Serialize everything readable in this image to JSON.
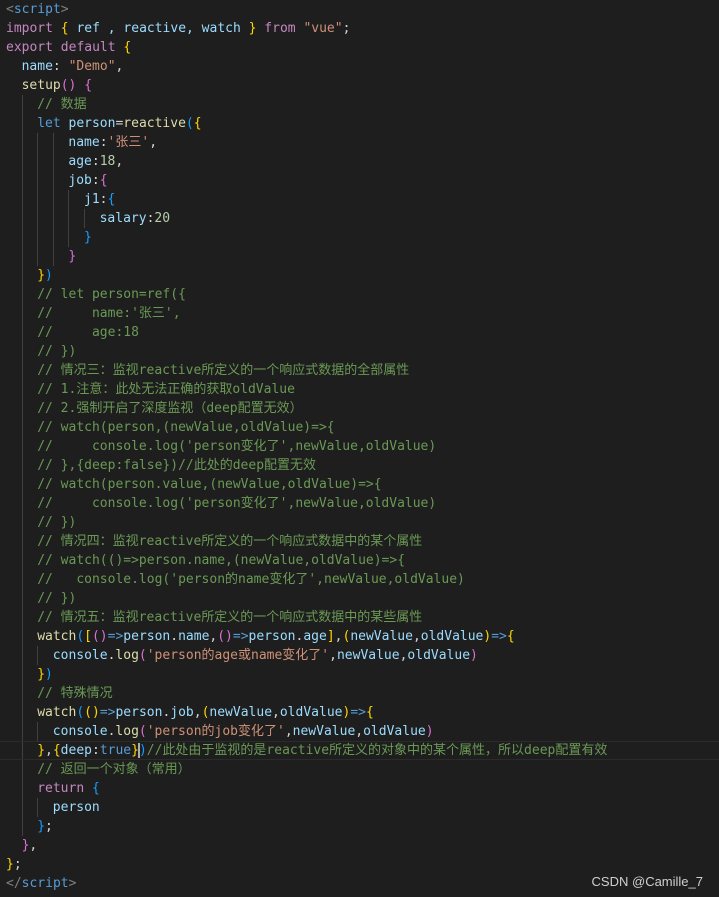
{
  "watermark": "CSDN @Camille_7",
  "lines": [
    {
      "indent": 0,
      "tokens": [
        {
          "t": "<",
          "c": "t-tag"
        },
        {
          "t": "script",
          "c": "t-tagname"
        },
        {
          "t": ">",
          "c": "t-tag"
        }
      ]
    },
    {
      "indent": 0,
      "tokens": [
        {
          "t": "import",
          "c": "t-kw"
        },
        {
          "t": " ",
          "c": "t-plain"
        },
        {
          "t": "{",
          "c": "t-br1"
        },
        {
          "t": " ref , reactive, watch ",
          "c": "t-var"
        },
        {
          "t": "}",
          "c": "t-br1"
        },
        {
          "t": " from ",
          "c": "t-kw"
        },
        {
          "t": "\"vue\"",
          "c": "t-str"
        },
        {
          "t": ";",
          "c": "t-plain"
        }
      ]
    },
    {
      "indent": 0,
      "tokens": [
        {
          "t": "export",
          "c": "t-kw"
        },
        {
          "t": " ",
          "c": "t-plain"
        },
        {
          "t": "default",
          "c": "t-kw"
        },
        {
          "t": " ",
          "c": "t-plain"
        },
        {
          "t": "{",
          "c": "t-br1"
        }
      ]
    },
    {
      "indent": 1,
      "tokens": [
        {
          "t": "name",
          "c": "t-var"
        },
        {
          "t": ": ",
          "c": "t-plain"
        },
        {
          "t": "\"Demo\"",
          "c": "t-str"
        },
        {
          "t": ",",
          "c": "t-plain"
        }
      ]
    },
    {
      "indent": 1,
      "tokens": [
        {
          "t": "setup",
          "c": "t-fn"
        },
        {
          "t": "()",
          "c": "t-br2"
        },
        {
          "t": " ",
          "c": "t-plain"
        },
        {
          "t": "{",
          "c": "t-br2"
        }
      ]
    },
    {
      "indent": 2,
      "tokens": [
        {
          "t": "// 数据",
          "c": "t-com"
        }
      ]
    },
    {
      "indent": 2,
      "tokens": [
        {
          "t": "let",
          "c": "t-kw2"
        },
        {
          "t": " ",
          "c": "t-plain"
        },
        {
          "t": "person",
          "c": "t-var"
        },
        {
          "t": "=",
          "c": "t-plain"
        },
        {
          "t": "reactive",
          "c": "t-fn"
        },
        {
          "t": "(",
          "c": "t-br3"
        },
        {
          "t": "{",
          "c": "t-br1"
        }
      ]
    },
    {
      "indent": 4,
      "tokens": [
        {
          "t": "name",
          "c": "t-var"
        },
        {
          "t": ":",
          "c": "t-plain"
        },
        {
          "t": "'张三'",
          "c": "t-str"
        },
        {
          "t": ",",
          "c": "t-plain"
        }
      ]
    },
    {
      "indent": 4,
      "tokens": [
        {
          "t": "age",
          "c": "t-var"
        },
        {
          "t": ":",
          "c": "t-plain"
        },
        {
          "t": "18",
          "c": "t-num"
        },
        {
          "t": ",",
          "c": "t-plain"
        }
      ]
    },
    {
      "indent": 4,
      "tokens": [
        {
          "t": "job",
          "c": "t-var"
        },
        {
          "t": ":",
          "c": "t-plain"
        },
        {
          "t": "{",
          "c": "t-br2"
        }
      ]
    },
    {
      "indent": 5,
      "tokens": [
        {
          "t": "j1",
          "c": "t-var"
        },
        {
          "t": ":",
          "c": "t-plain"
        },
        {
          "t": "{",
          "c": "t-br3"
        }
      ]
    },
    {
      "indent": 6,
      "tokens": [
        {
          "t": "salary",
          "c": "t-var"
        },
        {
          "t": ":",
          "c": "t-plain"
        },
        {
          "t": "20",
          "c": "t-num"
        }
      ]
    },
    {
      "indent": 5,
      "tokens": [
        {
          "t": "}",
          "c": "t-br3"
        }
      ]
    },
    {
      "indent": 4,
      "tokens": [
        {
          "t": "}",
          "c": "t-br2"
        }
      ]
    },
    {
      "indent": 2,
      "tokens": [
        {
          "t": "}",
          "c": "t-br1"
        },
        {
          "t": ")",
          "c": "t-br3"
        }
      ]
    },
    {
      "indent": 2,
      "tokens": [
        {
          "t": "// let person=ref({",
          "c": "t-com"
        }
      ]
    },
    {
      "indent": 2,
      "tokens": [
        {
          "t": "//     name:'张三',",
          "c": "t-com"
        }
      ]
    },
    {
      "indent": 2,
      "tokens": [
        {
          "t": "//     age:18",
          "c": "t-com"
        }
      ]
    },
    {
      "indent": 2,
      "tokens": [
        {
          "t": "// })",
          "c": "t-com"
        }
      ]
    },
    {
      "indent": 2,
      "tokens": [
        {
          "t": "// 情况三：监视reactive所定义的一个响应式数据的全部属性",
          "c": "t-com"
        }
      ]
    },
    {
      "indent": 2,
      "tokens": [
        {
          "t": "// 1.注意：此处无法正确的获取oldValue",
          "c": "t-com"
        }
      ]
    },
    {
      "indent": 2,
      "tokens": [
        {
          "t": "// 2.强制开启了深度监视（deep配置无效）",
          "c": "t-com"
        }
      ]
    },
    {
      "indent": 2,
      "tokens": [
        {
          "t": "// watch(person,(newValue,oldValue)=>{",
          "c": "t-com"
        }
      ]
    },
    {
      "indent": 2,
      "tokens": [
        {
          "t": "//     console.log('person变化了',newValue,oldValue)",
          "c": "t-com"
        }
      ]
    },
    {
      "indent": 2,
      "tokens": [
        {
          "t": "// },{deep:false})//此处的deep配置无效",
          "c": "t-com"
        }
      ]
    },
    {
      "indent": 2,
      "tokens": [
        {
          "t": "// watch(person.value,(newValue,oldValue)=>{",
          "c": "t-com"
        }
      ]
    },
    {
      "indent": 2,
      "tokens": [
        {
          "t": "//     console.log('person变化了',newValue,oldValue)",
          "c": "t-com"
        }
      ]
    },
    {
      "indent": 2,
      "tokens": [
        {
          "t": "// })",
          "c": "t-com"
        }
      ]
    },
    {
      "indent": 2,
      "tokens": [
        {
          "t": "// 情况四：监视reactive所定义的一个响应式数据中的某个属性",
          "c": "t-com"
        }
      ]
    },
    {
      "indent": 2,
      "tokens": [
        {
          "t": "// watch(()=>person.name,(newValue,oldValue)=>{",
          "c": "t-com"
        }
      ]
    },
    {
      "indent": 2,
      "tokens": [
        {
          "t": "//   console.log('person的name变化了',newValue,oldValue)",
          "c": "t-com"
        }
      ]
    },
    {
      "indent": 2,
      "tokens": [
        {
          "t": "// })",
          "c": "t-com"
        }
      ]
    },
    {
      "indent": 2,
      "tokens": [
        {
          "t": "// 情况五：监视reactive所定义的一个响应式数据中的某些属性",
          "c": "t-com"
        }
      ]
    },
    {
      "indent": 2,
      "tokens": [
        {
          "t": "watch",
          "c": "t-fn"
        },
        {
          "t": "(",
          "c": "t-br3"
        },
        {
          "t": "[",
          "c": "t-br1"
        },
        {
          "t": "()",
          "c": "t-br2"
        },
        {
          "t": "=>",
          "c": "t-kw2"
        },
        {
          "t": "person",
          "c": "t-var"
        },
        {
          "t": ".",
          "c": "t-plain"
        },
        {
          "t": "name",
          "c": "t-var"
        },
        {
          "t": ",",
          "c": "t-plain"
        },
        {
          "t": "()",
          "c": "t-br2"
        },
        {
          "t": "=>",
          "c": "t-kw2"
        },
        {
          "t": "person",
          "c": "t-var"
        },
        {
          "t": ".",
          "c": "t-plain"
        },
        {
          "t": "age",
          "c": "t-var"
        },
        {
          "t": "]",
          "c": "t-br1"
        },
        {
          "t": ",",
          "c": "t-plain"
        },
        {
          "t": "(",
          "c": "t-br1"
        },
        {
          "t": "newValue",
          "c": "t-var"
        },
        {
          "t": ",",
          "c": "t-plain"
        },
        {
          "t": "oldValue",
          "c": "t-var"
        },
        {
          "t": ")",
          "c": "t-br1"
        },
        {
          "t": "=>",
          "c": "t-kw2"
        },
        {
          "t": "{",
          "c": "t-br1"
        }
      ]
    },
    {
      "indent": 3,
      "tokens": [
        {
          "t": "console",
          "c": "t-var"
        },
        {
          "t": ".",
          "c": "t-plain"
        },
        {
          "t": "log",
          "c": "t-fn"
        },
        {
          "t": "(",
          "c": "t-br2"
        },
        {
          "t": "'person的age或name变化了'",
          "c": "t-str"
        },
        {
          "t": ",",
          "c": "t-plain"
        },
        {
          "t": "newValue",
          "c": "t-var"
        },
        {
          "t": ",",
          "c": "t-plain"
        },
        {
          "t": "oldValue",
          "c": "t-var"
        },
        {
          "t": ")",
          "c": "t-br2"
        }
      ]
    },
    {
      "indent": 2,
      "tokens": [
        {
          "t": "}",
          "c": "t-br1"
        },
        {
          "t": ")",
          "c": "t-br3"
        }
      ]
    },
    {
      "indent": 2,
      "tokens": [
        {
          "t": "// 特殊情况",
          "c": "t-com"
        }
      ]
    },
    {
      "indent": 2,
      "tokens": [
        {
          "t": "watch",
          "c": "t-fn"
        },
        {
          "t": "(",
          "c": "t-br3"
        },
        {
          "t": "()",
          "c": "t-br1"
        },
        {
          "t": "=>",
          "c": "t-kw2"
        },
        {
          "t": "person",
          "c": "t-var"
        },
        {
          "t": ".",
          "c": "t-plain"
        },
        {
          "t": "job",
          "c": "t-var"
        },
        {
          "t": ",",
          "c": "t-plain"
        },
        {
          "t": "(",
          "c": "t-br1"
        },
        {
          "t": "newValue",
          "c": "t-var"
        },
        {
          "t": ",",
          "c": "t-plain"
        },
        {
          "t": "oldValue",
          "c": "t-var"
        },
        {
          "t": ")",
          "c": "t-br1"
        },
        {
          "t": "=>",
          "c": "t-kw2"
        },
        {
          "t": "{",
          "c": "t-br1"
        }
      ]
    },
    {
      "indent": 3,
      "tokens": [
        {
          "t": "console",
          "c": "t-var"
        },
        {
          "t": ".",
          "c": "t-plain"
        },
        {
          "t": "log",
          "c": "t-fn"
        },
        {
          "t": "(",
          "c": "t-br2"
        },
        {
          "t": "'person的job变化了'",
          "c": "t-str"
        },
        {
          "t": ",",
          "c": "t-plain"
        },
        {
          "t": "newValue",
          "c": "t-var"
        },
        {
          "t": ",",
          "c": "t-plain"
        },
        {
          "t": "oldValue",
          "c": "t-var"
        },
        {
          "t": ")",
          "c": "t-br2"
        }
      ]
    },
    {
      "indent": 2,
      "current": true,
      "tokens": [
        {
          "t": "}",
          "c": "t-br1"
        },
        {
          "t": ",",
          "c": "t-plain"
        },
        {
          "t": "{",
          "c": "t-br1"
        },
        {
          "t": "deep",
          "c": "t-var"
        },
        {
          "t": ":",
          "c": "t-plain"
        },
        {
          "t": "true",
          "c": "t-kw2"
        },
        {
          "t": "}",
          "c": "t-br1"
        },
        {
          "t": "|",
          "c": "cursor"
        },
        {
          "t": ")",
          "c": "t-br3"
        },
        {
          "t": "//此处由于监视的是reactive所定义的对象中的某个属性，所以deep配置有效",
          "c": "t-com"
        }
      ]
    },
    {
      "indent": 2,
      "tokens": [
        {
          "t": "// 返回一个对象（常用）",
          "c": "t-com"
        }
      ]
    },
    {
      "indent": 2,
      "tokens": [
        {
          "t": "return",
          "c": "t-kw"
        },
        {
          "t": " ",
          "c": "t-plain"
        },
        {
          "t": "{",
          "c": "t-br3"
        }
      ]
    },
    {
      "indent": 3,
      "tokens": [
        {
          "t": "person",
          "c": "t-var"
        }
      ]
    },
    {
      "indent": 2,
      "tokens": [
        {
          "t": "}",
          "c": "t-br3"
        },
        {
          "t": ";",
          "c": "t-plain"
        }
      ]
    },
    {
      "indent": 1,
      "tokens": [
        {
          "t": "}",
          "c": "t-br2"
        },
        {
          "t": ",",
          "c": "t-plain"
        }
      ]
    },
    {
      "indent": 0,
      "tokens": [
        {
          "t": "}",
          "c": "t-br1"
        },
        {
          "t": ";",
          "c": "t-plain"
        }
      ]
    },
    {
      "indent": 0,
      "tokens": [
        {
          "t": "</",
          "c": "t-tag"
        },
        {
          "t": "script",
          "c": "t-tagname"
        },
        {
          "t": ">",
          "c": "t-tag"
        }
      ]
    }
  ]
}
